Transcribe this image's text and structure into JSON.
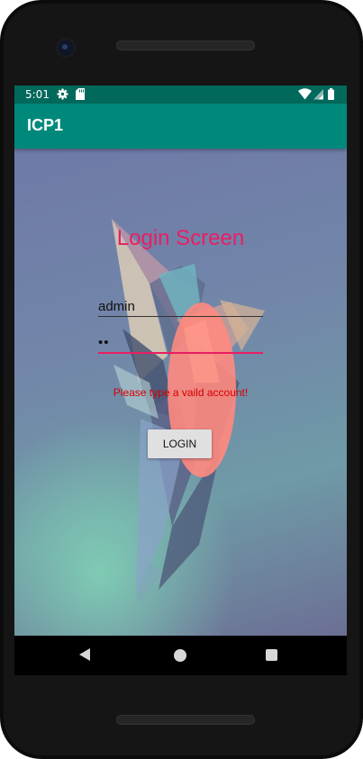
{
  "status_bar": {
    "time": "5:01",
    "left_icons": [
      "gear-icon",
      "sd-card-icon"
    ],
    "right_icons": [
      "wifi-icon",
      "signal-icon",
      "battery-icon"
    ]
  },
  "app_bar": {
    "title": "ICP1"
  },
  "login": {
    "title": "Login Screen",
    "username_value": "admin",
    "password_value": "••",
    "error_message": "Please type a vaild account!",
    "button_label": "LOGIN"
  },
  "colors": {
    "status_bar": "#00695c",
    "app_bar": "#00897b",
    "accent": "#e91e63",
    "error": "#d50000",
    "button": "#e0e0e0"
  },
  "nav_bar": {
    "icons": [
      "back-icon",
      "home-icon",
      "recents-icon"
    ]
  }
}
